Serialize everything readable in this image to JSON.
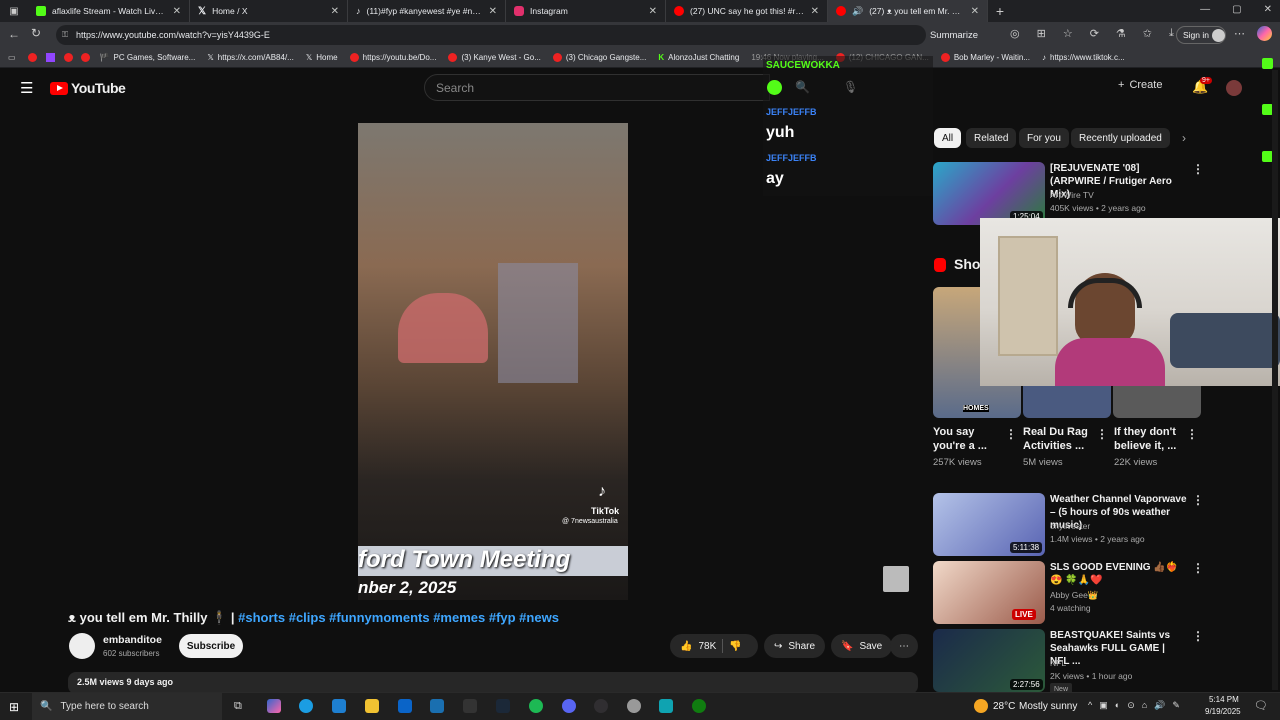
{
  "browser": {
    "tabs": [
      {
        "title": "aflaxlife Stream - Watch Live on K",
        "color": "#53fc18"
      },
      {
        "title": "Home / X",
        "color": "#000000"
      },
      {
        "title": "(11)#fyp #kanyewest #ye #new #",
        "color": "#000000"
      },
      {
        "title": "Instagram",
        "color": "#e1306c"
      },
      {
        "title": "(27) UNC say he got this! #reels",
        "color": "#ff0000"
      },
      {
        "title": "(27) ᴥ you tell em Mr. Thilly",
        "color": "#ff0000"
      }
    ],
    "url": "https://www.youtube.com/watch?v=yisY4439G-E",
    "summarize": "Summarize",
    "signin": "Sign in",
    "bookmarks": [
      "PC Games, Software...",
      "https://x.com/AB84/...",
      "Home",
      "https://youtu.be/Do...",
      "(3) Kanye West - Go...",
      "(3) Chicago Gangste...",
      "AlonzoJust Chatting",
      "19:46 Now playing...",
      "(12) CHICAGO GAN...",
      "Bob Marley - Waitin...",
      "https://www.tiktok.c..."
    ]
  },
  "youtube": {
    "logo": "YouTube",
    "search_placeholder": "Search",
    "create": "Create",
    "notif_badge": "9+",
    "chips": [
      "All",
      "Related",
      "For you",
      "Recently uploaded"
    ],
    "video": {
      "overlay_line1": "ford Town Meeting",
      "overlay_line2": "nber 2, 2025",
      "tiktok": "TikTok",
      "tiktok_user": "@ 7newsaustralia",
      "title_prefix": "ᴥ you tell em Mr. Thilly 🕴️ | ",
      "hashtags": "#shorts #clips #funnymoments #memes #fyp #news",
      "channel": "embanditoe",
      "subs": "602 subscribers",
      "subscribe": "Subscribe",
      "likes": "78K",
      "share": "Share",
      "save": "Save",
      "views": "2.5M views  9 days ago"
    },
    "sidebar": [
      {
        "title": "[REJUVENATE '08] (ARPWIRE / Frutiger Aero Mix)",
        "channel": "ArpWire TV",
        "meta": "405K views • 2 years ago",
        "dur": "1:25:04"
      },
      {
        "title": "Weather Channel Vaporwave – (5 hours of 90s weather music)",
        "channel": "chyllvester",
        "meta": "1.4M views • 2 years ago",
        "dur": "5:11:38"
      },
      {
        "title": "SLS GOOD EVENING 👍🏾❤️‍🔥😍 🍀🙏❤️",
        "channel": "Abby Gee👑",
        "meta": "4 watching",
        "dur": "LIVE"
      },
      {
        "title": "BEASTQUAKE! Saints vs Seahawks FULL GAME | NFL ...",
        "channel": "NFL",
        "meta": "2K views • 1 hour ago",
        "dur": "2:27:56",
        "badge": "New"
      }
    ],
    "shorts_label": "Sho",
    "shorts": [
      {
        "title": "You say you're a ...",
        "views": "257K views"
      },
      {
        "title": "Real Du Rag Activities ...",
        "views": "5M views"
      },
      {
        "title": "If they don't believe it, ...",
        "views": "22K views"
      }
    ]
  },
  "chat": {
    "channel": "SAUCEWOKKA",
    "messages": [
      {
        "user": "JEFFJEFFB",
        "text": "yuh"
      },
      {
        "user": "JEFFJEFFB",
        "text": "ay"
      }
    ]
  },
  "taskbar": {
    "search": "Type here to search",
    "temp": "28°C",
    "weather": "Mostly sunny",
    "time": "5:14 PM",
    "date": "9/19/2025"
  }
}
